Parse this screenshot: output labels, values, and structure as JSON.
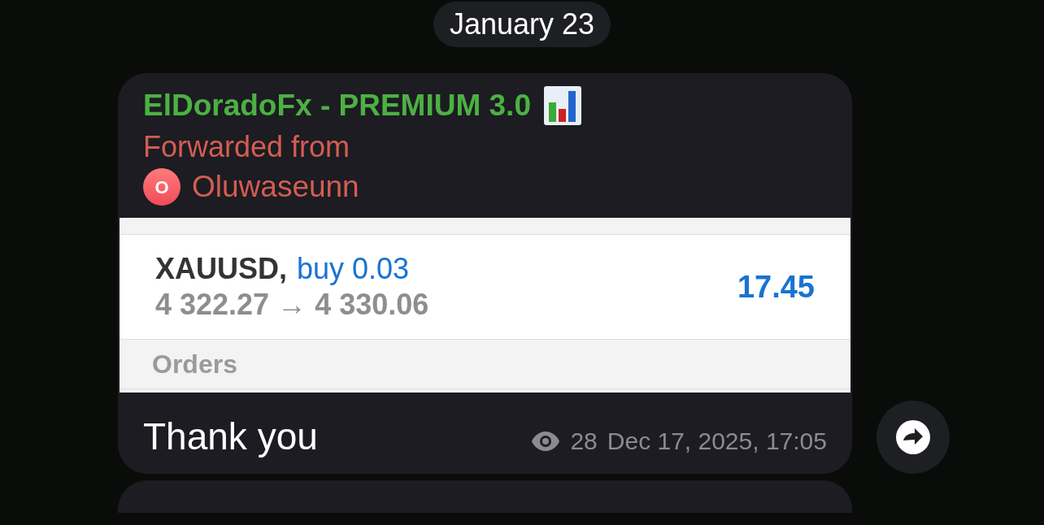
{
  "date_divider": "January 23",
  "message": {
    "channel": "ElDoradoFx - PREMIUM 3.0",
    "forwarded_label": "Forwarded from",
    "author": {
      "initial": "O",
      "name": "Oluwaseunn"
    },
    "screenshot": {
      "trade": {
        "symbol": "XAUUSD,",
        "action": "buy 0.03",
        "prices": "4 322.27 → 4 330.06",
        "profit": "17.45"
      },
      "section": "Orders"
    },
    "text": "Thank you",
    "views": "28",
    "timestamp": "Dec 17, 2025, 17:05"
  }
}
